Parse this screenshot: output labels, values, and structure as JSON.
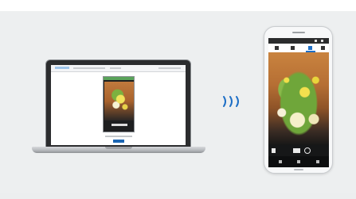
{
  "banner": {
    "title": "",
    "title_color": "#1d6fc2"
  },
  "laptop": {
    "browser": {
      "accent": "#5aa35a",
      "button_color": "#1b66b3"
    }
  },
  "connection": {
    "icon": "wireless-waves-icon",
    "color": "#1e6fc6"
  },
  "phone": {
    "toolbar_accent": "#1e6fc6",
    "icons": [
      "grid-icon",
      "list-icon",
      "cast-icon",
      "settings-icon"
    ],
    "media_icons": [
      "rewind-icon",
      "record-icon",
      "stop-icon"
    ],
    "nav_icons": [
      "back-icon",
      "home-icon",
      "recent-apps-icon"
    ]
  }
}
